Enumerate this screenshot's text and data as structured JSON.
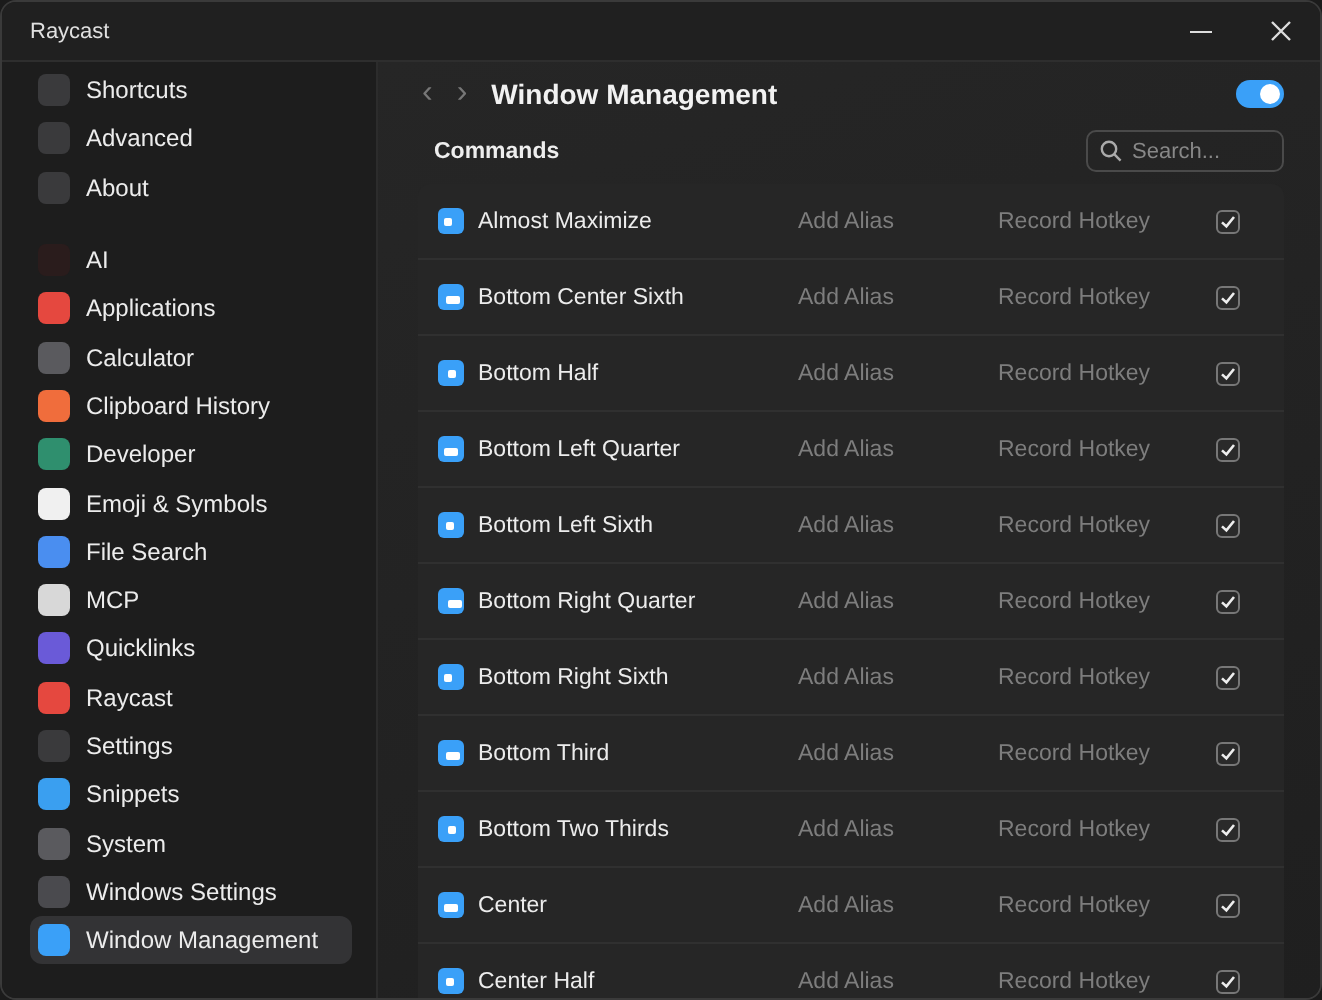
{
  "window": {
    "title": "Raycast"
  },
  "sidebar": {
    "groups": [
      {
        "items": [
          {
            "label": "Shortcuts",
            "color": "#3a3a3c",
            "selected": false
          },
          {
            "label": "Advanced",
            "color": "#3a3a3c",
            "selected": false
          },
          {
            "label": "About",
            "color": "#3a3a3c",
            "selected": false
          }
        ]
      },
      {
        "items": [
          {
            "label": "AI",
            "color": "#2a1c1c",
            "selected": false
          },
          {
            "label": "Applications",
            "color": "#e5483f",
            "selected": false
          },
          {
            "label": "Calculator",
            "color": "#5a5a5e",
            "selected": false
          },
          {
            "label": "Clipboard History",
            "color": "#f06d3c",
            "selected": false
          },
          {
            "label": "Developer",
            "color": "#2f8f6e",
            "selected": false
          },
          {
            "label": "Emoji & Symbols",
            "color": "#f0f0f0",
            "selected": false
          },
          {
            "label": "File Search",
            "color": "#4a8ef0",
            "selected": false
          },
          {
            "label": "MCP",
            "color": "#d8d8d8",
            "selected": false
          },
          {
            "label": "Quicklinks",
            "color": "#6a5ad8",
            "selected": false
          },
          {
            "label": "Raycast",
            "color": "#e5483f",
            "selected": false
          },
          {
            "label": "Settings",
            "color": "#3a3a3c",
            "selected": false
          },
          {
            "label": "Snippets",
            "color": "#3a9ff0",
            "selected": false
          },
          {
            "label": "System",
            "color": "#5a5a5e",
            "selected": false
          },
          {
            "label": "Windows Settings",
            "color": "#4a4a4e",
            "selected": false
          },
          {
            "label": "Window Management",
            "color": "#3aa0f8",
            "selected": true
          }
        ]
      }
    ]
  },
  "header": {
    "back": "‹",
    "forward": "›",
    "title": "Window Management",
    "enabled": true
  },
  "commands": {
    "title": "Commands",
    "search": {
      "placeholder": "Search..."
    },
    "rows": [
      {
        "name": "Almost Maximize",
        "alias": "Add Alias",
        "hotkey": "Record Hotkey",
        "checked": true
      },
      {
        "name": "Bottom Center Sixth",
        "alias": "Add Alias",
        "hotkey": "Record Hotkey",
        "checked": true
      },
      {
        "name": "Bottom Half",
        "alias": "Add Alias",
        "hotkey": "Record Hotkey",
        "checked": true
      },
      {
        "name": "Bottom Left Quarter",
        "alias": "Add Alias",
        "hotkey": "Record Hotkey",
        "checked": true
      },
      {
        "name": "Bottom Left Sixth",
        "alias": "Add Alias",
        "hotkey": "Record Hotkey",
        "checked": true
      },
      {
        "name": "Bottom Right Quarter",
        "alias": "Add Alias",
        "hotkey": "Record Hotkey",
        "checked": true
      },
      {
        "name": "Bottom Right Sixth",
        "alias": "Add Alias",
        "hotkey": "Record Hotkey",
        "checked": true
      },
      {
        "name": "Bottom Third",
        "alias": "Add Alias",
        "hotkey": "Record Hotkey",
        "checked": true
      },
      {
        "name": "Bottom Two Thirds",
        "alias": "Add Alias",
        "hotkey": "Record Hotkey",
        "checked": true
      },
      {
        "name": "Center",
        "alias": "Add Alias",
        "hotkey": "Record Hotkey",
        "checked": true
      },
      {
        "name": "Center Half",
        "alias": "Add Alias",
        "hotkey": "Record Hotkey",
        "checked": true
      }
    ]
  }
}
